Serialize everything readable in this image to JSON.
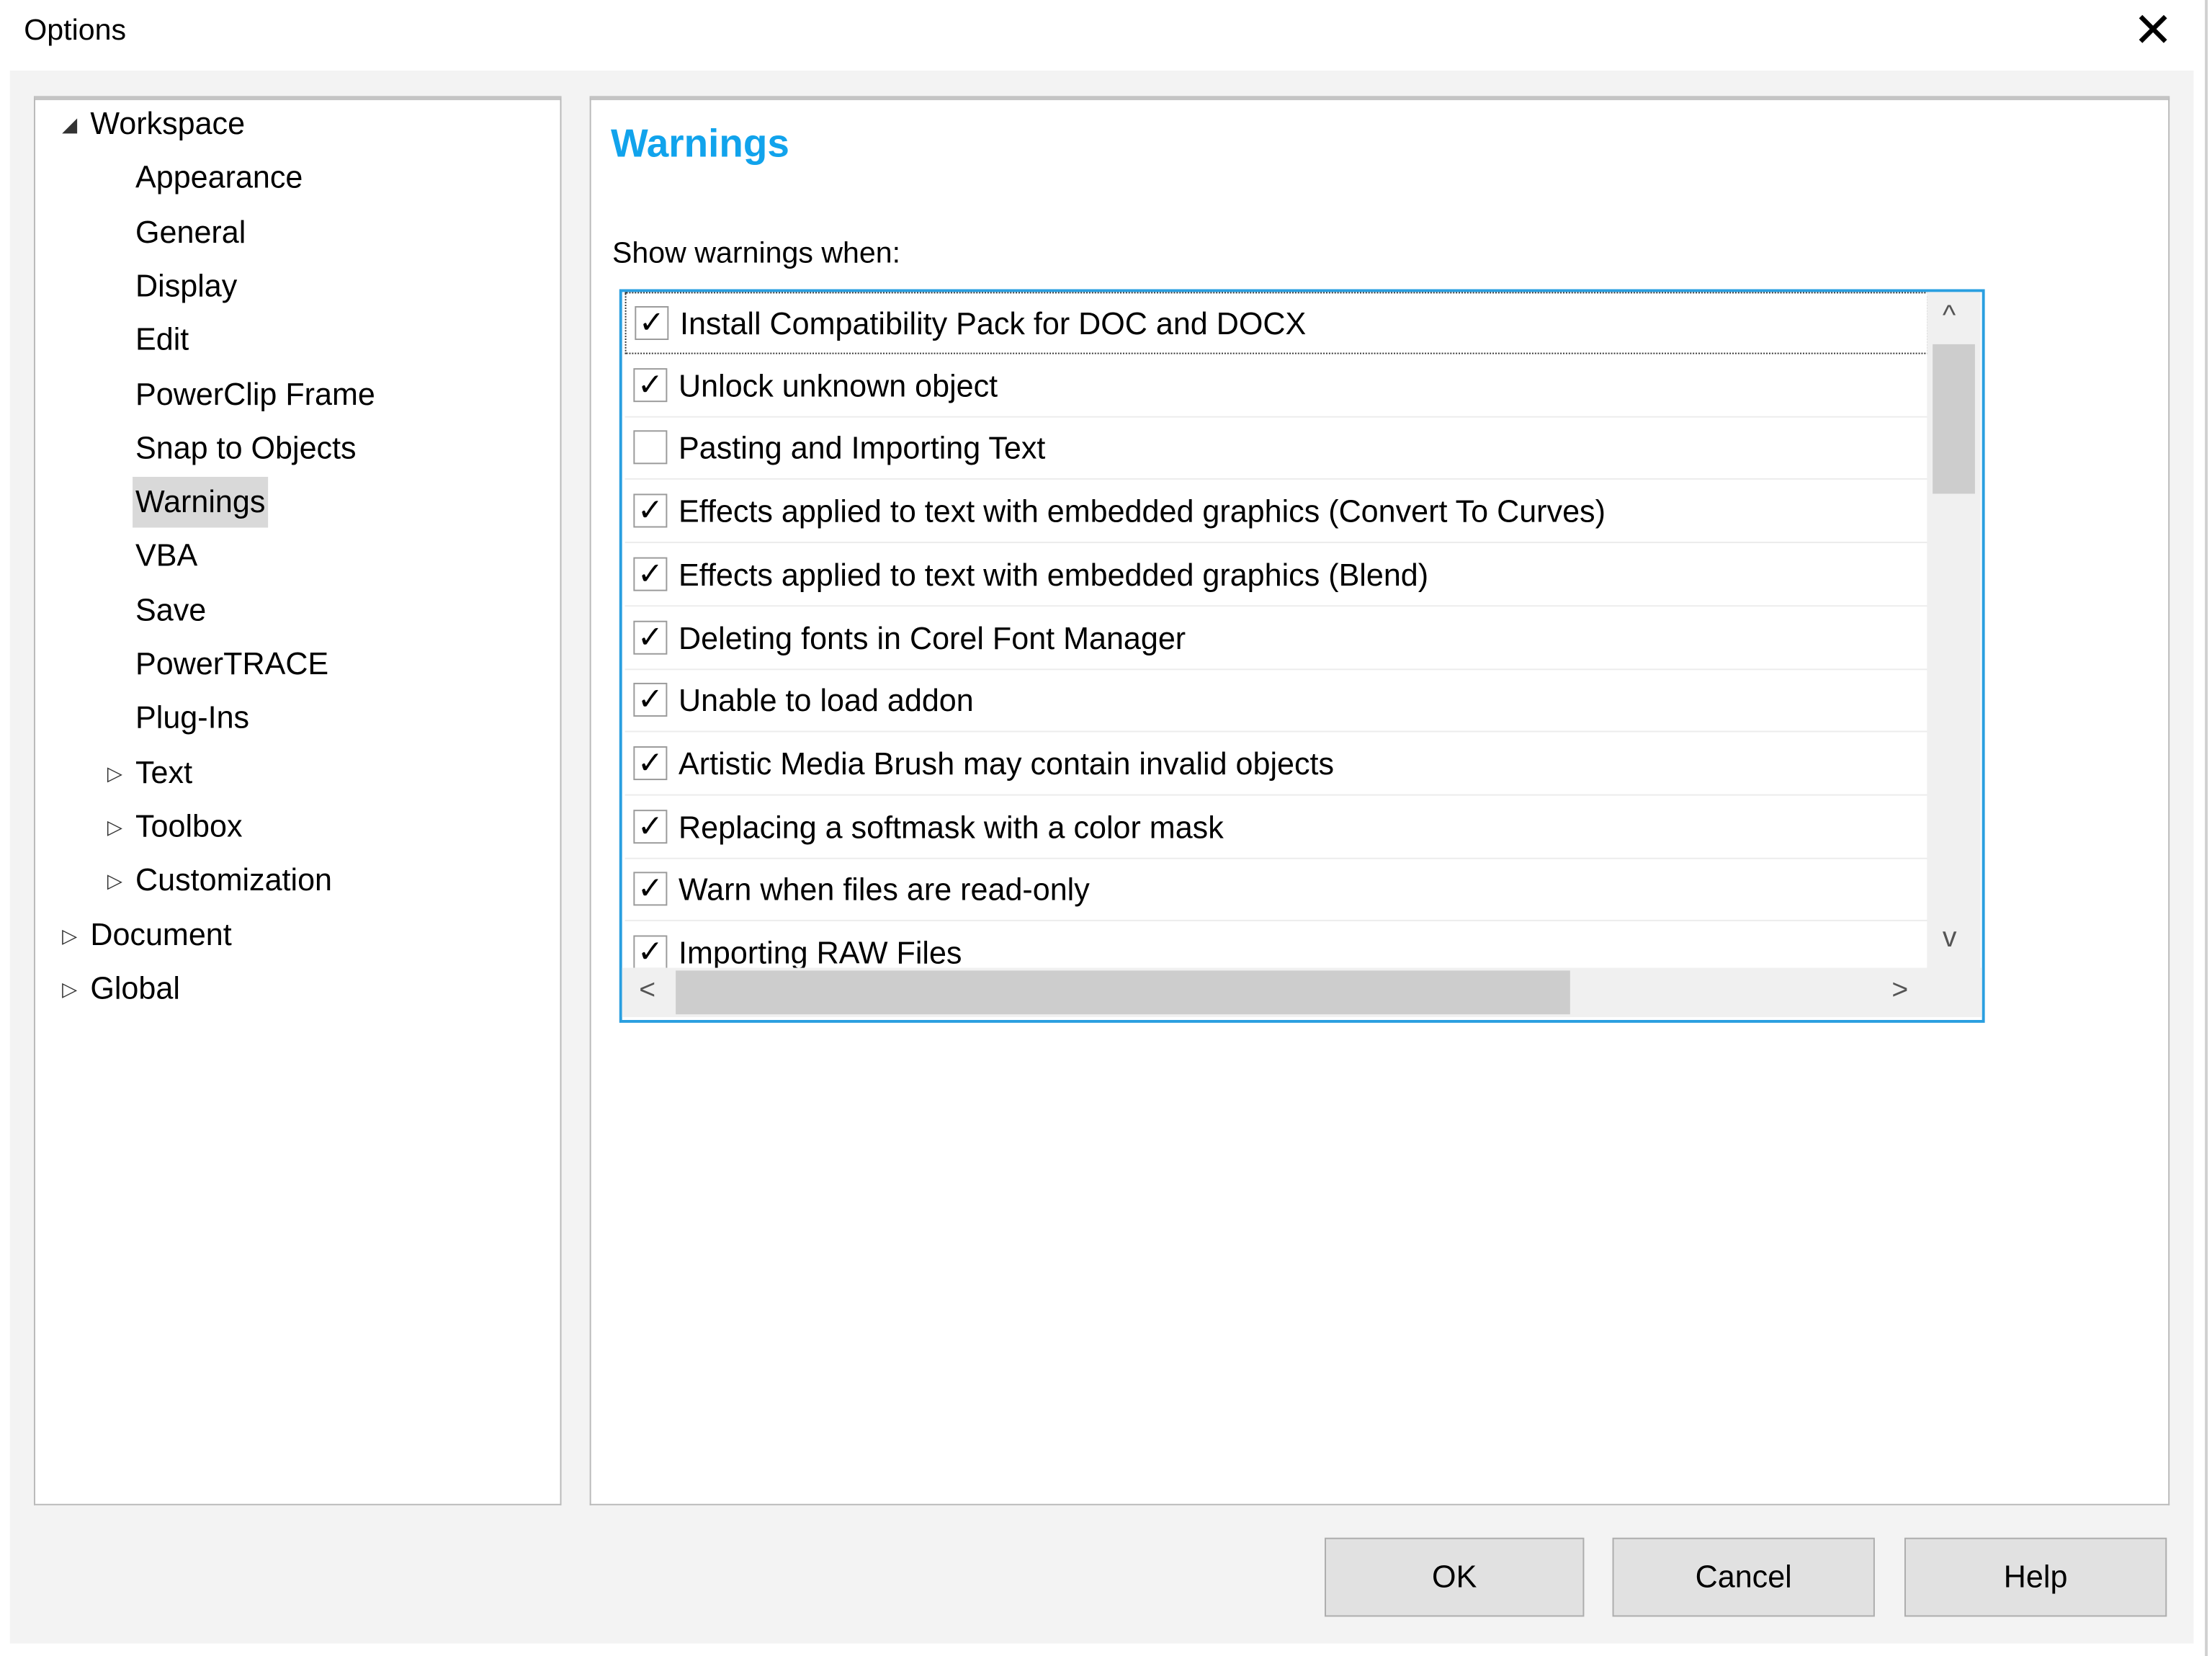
{
  "window": {
    "title": "Options",
    "close_icon": "close-icon"
  },
  "tree": {
    "items": [
      {
        "label": "Workspace",
        "level": 0,
        "expanded": true
      },
      {
        "label": "Appearance",
        "level": 1
      },
      {
        "label": "General",
        "level": 1
      },
      {
        "label": "Display",
        "level": 1
      },
      {
        "label": "Edit",
        "level": 1
      },
      {
        "label": "PowerClip Frame",
        "level": 1
      },
      {
        "label": "Snap to Objects",
        "level": 1
      },
      {
        "label": "Warnings",
        "level": 1,
        "selected": true
      },
      {
        "label": "VBA",
        "level": 1
      },
      {
        "label": "Save",
        "level": 1
      },
      {
        "label": "PowerTRACE",
        "level": 1
      },
      {
        "label": "Plug-Ins",
        "level": 1
      },
      {
        "label": "Text",
        "level": 1,
        "expanded": false
      },
      {
        "label": "Toolbox",
        "level": 1,
        "expanded": false
      },
      {
        "label": "Customization",
        "level": 1,
        "expanded": false
      },
      {
        "label": "Document",
        "level": 0,
        "expanded": false
      },
      {
        "label": "Global",
        "level": 0,
        "expanded": false
      }
    ]
  },
  "main": {
    "heading": "Warnings",
    "heading_color": "#11a3ec",
    "show_label": "Show warnings when:",
    "warnings": [
      {
        "label": "Install Compatibility Pack for DOC and DOCX",
        "checked": true
      },
      {
        "label": "Unlock unknown object",
        "checked": true
      },
      {
        "label": "Pasting and Importing Text",
        "checked": false
      },
      {
        "label": "Effects applied to text with embedded graphics (Convert To Curves)",
        "checked": true
      },
      {
        "label": "Effects applied to text with embedded graphics (Blend)",
        "checked": true
      },
      {
        "label": "Deleting fonts in Corel Font Manager",
        "checked": true
      },
      {
        "label": "Unable to load addon",
        "checked": true
      },
      {
        "label": "Artistic Media Brush may contain invalid objects",
        "checked": true
      },
      {
        "label": "Replacing a softmask with a color mask",
        "checked": true
      },
      {
        "label": "Warn when files are read-only",
        "checked": true
      },
      {
        "label": "Importing RAW Files",
        "checked": true
      }
    ]
  },
  "buttons": {
    "ok": "OK",
    "cancel": "Cancel",
    "help": "Help"
  },
  "glyphs": {
    "check": "✓",
    "expanded": "◢",
    "collapsed": "▷",
    "up": "^",
    "down": "v",
    "left": "<",
    "right": ">",
    "close": "✕"
  }
}
